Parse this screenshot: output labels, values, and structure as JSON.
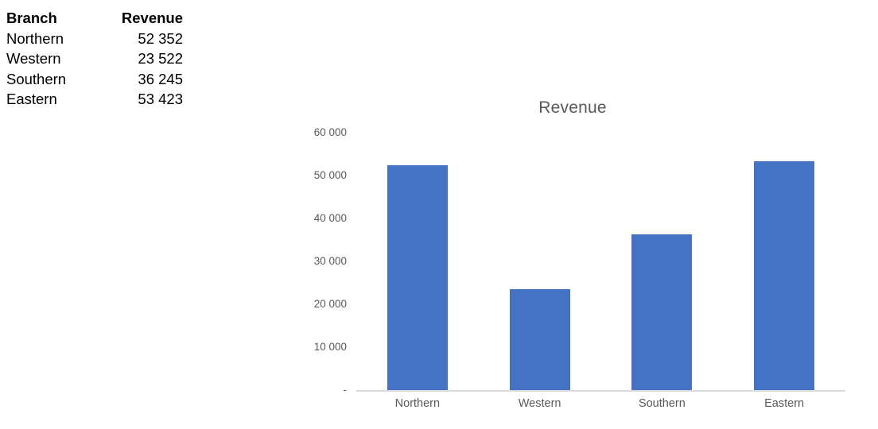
{
  "table": {
    "headers": [
      "Branch",
      "Revenue"
    ],
    "rows": [
      {
        "branch": "Northern",
        "revenue": "52 352"
      },
      {
        "branch": "Western",
        "revenue": "23 522"
      },
      {
        "branch": "Southern",
        "revenue": "36 245"
      },
      {
        "branch": "Eastern",
        "revenue": "53 423"
      }
    ]
  },
  "chart_data": {
    "type": "bar",
    "title": "Revenue",
    "xlabel": "",
    "ylabel": "",
    "categories": [
      "Northern",
      "Western",
      "Southern",
      "Eastern"
    ],
    "values": [
      52352,
      23522,
      36245,
      53423
    ],
    "ylim": [
      0,
      60000
    ],
    "ytick_values": [
      0,
      10000,
      20000,
      30000,
      40000,
      50000,
      60000
    ],
    "ytick_labels": [
      "-",
      "10 000",
      "20 000",
      "30 000",
      "40 000",
      "50 000",
      "60 000"
    ],
    "grid": false,
    "legend": false,
    "series_color": "#4472C4",
    "axis_color": "#D9D9D9",
    "text_color": "#595959"
  }
}
